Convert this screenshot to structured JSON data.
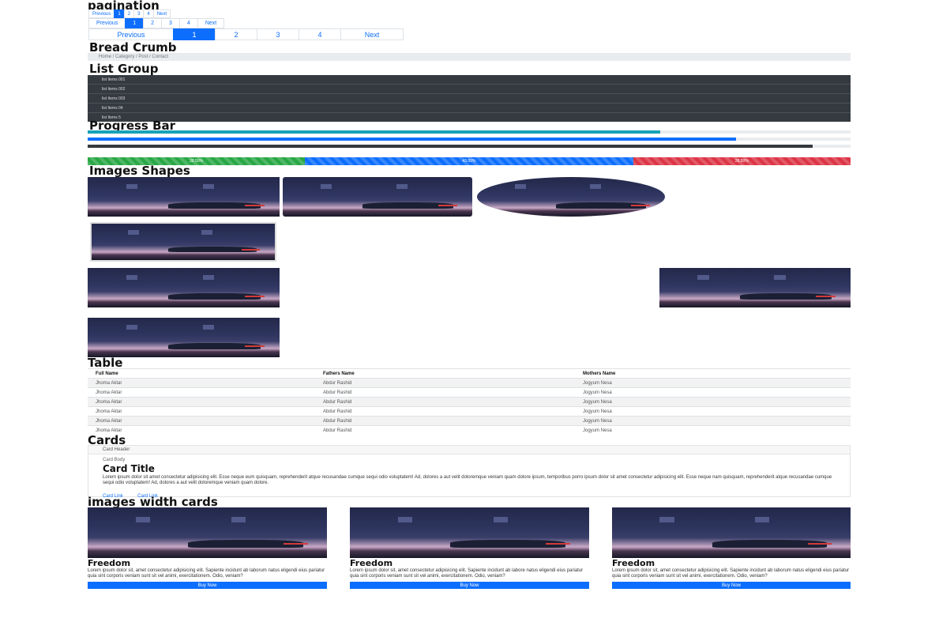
{
  "sections": {
    "pagination": "pagination",
    "breadcrumb": "Bread Crumb",
    "list_group": "List Group",
    "progress": "Progress Bar",
    "images": "Images Shapes",
    "table": "Table",
    "cards": "Cards",
    "image_cards": "images width cards"
  },
  "pagination": {
    "previous": "Previous",
    "next": "Next",
    "pages": [
      "1",
      "2",
      "3",
      "4"
    ],
    "active_page": "1"
  },
  "breadcrumb": "Home / Category / Post / Contact",
  "list_group": [
    "list Items 001",
    "list Items 002",
    "list Items 003",
    "list Items 04",
    "list Items 5"
  ],
  "progress": {
    "bars": [
      {
        "value": 75,
        "color": "#17a2b8"
      },
      {
        "value": 85,
        "color": "#0d6efd"
      },
      {
        "value": 95,
        "color": "#343a40"
      }
    ],
    "stacked": [
      {
        "value": 28.5,
        "label": "28.50%",
        "color": "#28a745"
      },
      {
        "value": 43,
        "label": "43.00%",
        "color": "#0d6efd"
      },
      {
        "value": 28.5,
        "label": "28.50%",
        "color": "#dc3545"
      }
    ]
  },
  "table": {
    "headers": [
      "Full Name",
      "Fathers Name",
      "Mothers Name"
    ],
    "rows": [
      [
        "Jhoma Aktar",
        "Abdur Rashid",
        "Jogyum Nesa"
      ],
      [
        "Jhoma Aktar",
        "Abdur Rashid",
        "Jogyum Nesa"
      ],
      [
        "Jhoma Aktar",
        "Abdur Rashid",
        "Jogyum Nesa"
      ],
      [
        "Jhoma Aktar",
        "Abdur Rashid",
        "Jogyum Nesa"
      ],
      [
        "Jhoma Aktar",
        "Abdur Rashid",
        "Jogyum Nesa"
      ],
      [
        "Jhoma Aktar",
        "Abdur Rashid",
        "Jogyum Nesa"
      ]
    ]
  },
  "card": {
    "header": "Card Header",
    "body_label": "Card Body",
    "title": "Card Title",
    "text": "Lorem ipsum dolor sit amet consectetur adipisicing elit. Esse neque eum quisquam, reprehenderit atque recusandae cumque sequi odio voluptatem! Ad, dolores a aut velit doloremque veniam quam dolore ipsum, temporibus porro ipsum dolor sit amet consectetur adipisicing elit. Esse neque nam quisquam, reprehenderit atque recusandae cumque sequi odio voluptatem! Ad, dolores a aut velit doloremque veniam quam dolore.",
    "link1": "Card Link",
    "link2": "Card Link"
  },
  "image_cards": [
    {
      "title": "Freedom",
      "text": "Lorem ipsum dolor sit, amet consectetur adipisicing elit. Sapiente incidunt ab laborum natus eligendi eius pariatur quia sint corporis veniam sunt sit vel animi, exercitationem. Odio, veniam?",
      "button": "Buy Now"
    },
    {
      "title": "Freedom",
      "text": "Lorem ipsum dolor sit, amet consectetur adipisicing elit. Sapiente incidunt ab labore natus eligendi eius pariatur quia sint corporis veniam sunt sit vel animi, exercitationem. Odio, veniam?",
      "button": "Buy Now"
    },
    {
      "title": "Freedom",
      "text": "Lorem ipsum dolor sit, amet consectetur adipisicing elit. Sapiente incidunt ab laborum natus eligendi eius pariatur quia sint corporis veniam sunt sit vel animi, exercitationem. Odio, veniam?",
      "button": "Buy Now"
    }
  ]
}
